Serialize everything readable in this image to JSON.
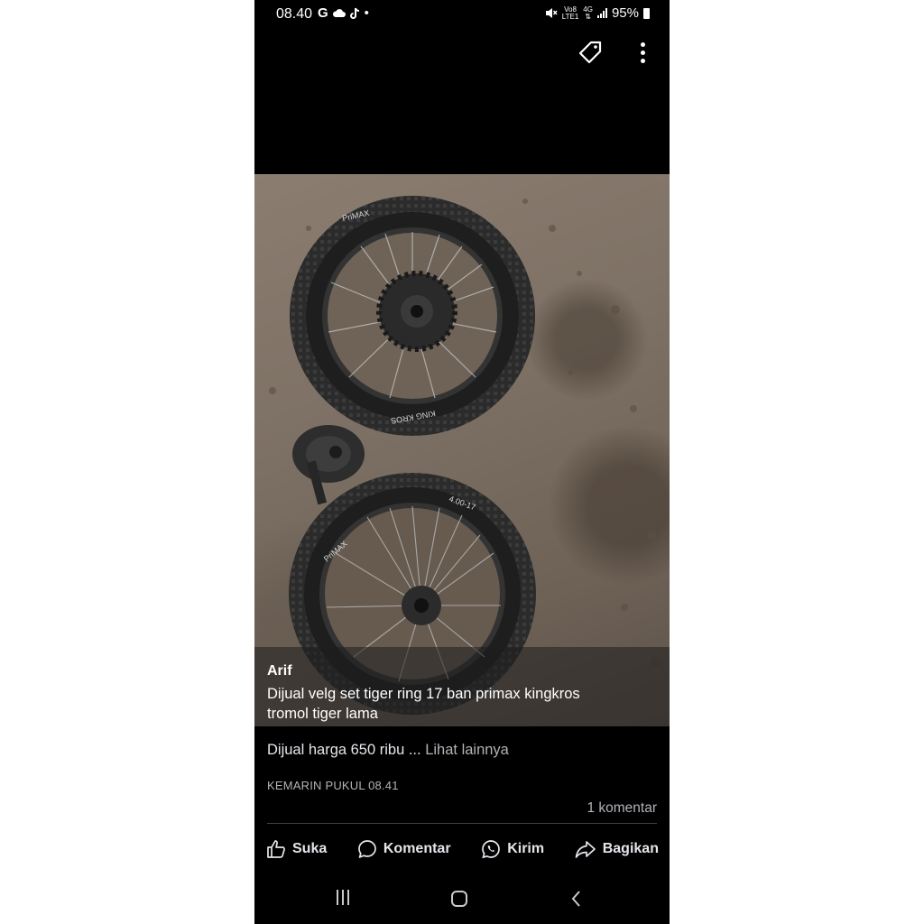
{
  "status_bar": {
    "time": "08.40",
    "left_icons": [
      "google-icon",
      "cloud-icon",
      "tiktok-icon",
      "dot-icon"
    ],
    "google_glyph": "G",
    "dot_glyph": "•",
    "volte_label_top": "Vo8",
    "volte_label_bottom": "LTE1",
    "network_label": "4G",
    "battery_percent": "95%"
  },
  "top_bar": {
    "icons": [
      "tag-icon",
      "more-vertical-icon"
    ]
  },
  "post": {
    "author": "Arif",
    "caption": "Dijual velg set tiger ring 17 ban primax kingkros\ntromol tiger lama",
    "body_text": "Dijual harga 650 ribu ...",
    "see_more": "Lihat lainnya",
    "timestamp": "KEMARIN PUKUL 08.41",
    "comment_count": "1 komentar",
    "tire_text_1": "PriMAX",
    "tire_text_2": "4.00-17",
    "tire_text_3": "KING KROS"
  },
  "actions": {
    "like": "Suka",
    "comment": "Komentar",
    "send": "Kirim",
    "share": "Bagikan"
  },
  "colors": {
    "background": "#000000",
    "text_primary": "#e4e6eb",
    "text_secondary": "#b0b3b8"
  }
}
